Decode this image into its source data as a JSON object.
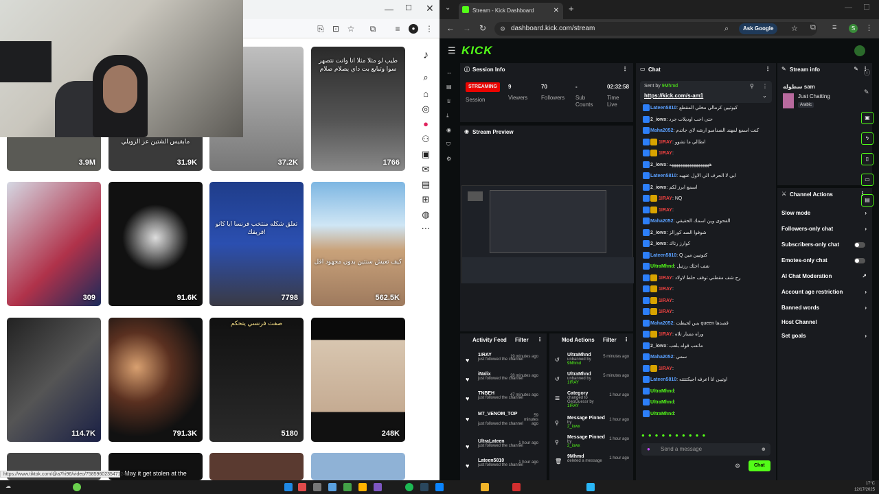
{
  "left_browser": {
    "status_url": "https://www.tiktok.com/@a7hi96/video/7585960235471244551",
    "tiles": [
      {
        "count": "3.9M",
        "caption": ""
      },
      {
        "count": "31.9K",
        "caption": "مابقيس الشتين عز الزويلي"
      },
      {
        "count": "37.2K",
        "caption": ""
      },
      {
        "count": "1766",
        "caption": "طيب لو مثلا مثلا انا وانت نتصهر سوا وتبايع بت داي يصلام صلام"
      },
      {
        "count": "309",
        "caption": ""
      },
      {
        "count": "91.6K",
        "caption": ""
      },
      {
        "count": "7798",
        "caption": "تعلق شكله منتخب فرنسا ايا كانو فريقك!"
      },
      {
        "count": "562.5K",
        "caption": "كيف تعيش سنتين بدون مجهود اقل"
      },
      {
        "count": "114.7K",
        "caption": ""
      },
      {
        "count": "791.3K",
        "caption": ""
      },
      {
        "count": "5180",
        "caption": "صفت فرنسي يتحكم"
      },
      {
        "count": "248K",
        "caption": ""
      },
      {
        "count": "",
        "caption": ""
      },
      {
        "count": "",
        "caption": "May it get stolen at the"
      },
      {
        "count": "",
        "caption": ""
      },
      {
        "count": "",
        "caption": ""
      }
    ]
  },
  "right_browser": {
    "tab_title": "Stream - Kick Dashboard",
    "url": "dashboard.kick.com/stream",
    "ask_google": "Ask Google",
    "logo": "KICK",
    "session": {
      "title": "Session Info",
      "status": "STREAMING",
      "session_label": "Session",
      "viewers_value": "9",
      "viewers_label": "Viewers",
      "followers_value": "70",
      "followers_label": "Followers",
      "subs_value": "-",
      "subs_label": "Sub Counts",
      "time_value": "02:32:58",
      "time_label": "Time Live"
    },
    "preview_title": "Stream Preview",
    "activity": {
      "title": "Activity Feed",
      "filter": "Filter",
      "items": [
        {
          "name": "1IRAY",
          "action": "just followed the channel",
          "time": "19 minutes ago"
        },
        {
          "name": "iNalix",
          "action": "just followed the channel",
          "time": "28 minutes ago"
        },
        {
          "name": "TNBEH",
          "action": "just followed the channel",
          "time": "47 minutes ago"
        },
        {
          "name": "M7_VENOM_TOP",
          "action": "just followed the channel",
          "time": "59 minutes ago"
        },
        {
          "name": "UltraLateen",
          "action": "just followed the channel",
          "time": "1 hour ago"
        },
        {
          "name": "Lateen5810",
          "action": "just followed the channel",
          "time": "1 hour ago"
        }
      ]
    },
    "mod": {
      "title": "Mod Actions",
      "filter": "Filter",
      "items": [
        {
          "name": "UltraMhnd",
          "l1": "unbanned by",
          "l2": "9Mhmd",
          "time": "5 minutes ago"
        },
        {
          "name": "UltraMhnd",
          "l1": "unbanned by",
          "l2": "1IRAY",
          "time": "5 minutes ago"
        },
        {
          "name": "Category",
          "l1": "changed to GeoGuessr by",
          "l2": "1IRAY",
          "time": "1 hour ago"
        },
        {
          "name": "Message Pinned",
          "l1": "by",
          "l2": "2_iowx",
          "time": "1 hour ago"
        },
        {
          "name": "Message Pinned",
          "l1": "by",
          "l2": "2_iowx",
          "time": "1 hour ago"
        },
        {
          "name": "9Mhmd",
          "l1": "deleted a message",
          "l2": "",
          "time": "1 hour ago"
        }
      ]
    },
    "chat": {
      "title": "Chat",
      "pinned_by": "Sent by",
      "pinned_user": "9Mhmd",
      "pinned_link": "https://kick.com/s-am1",
      "messages": [
        {
          "user": "Lateen5810",
          "text": "كيوتيين كرمالي مخلي المقطع"
        },
        {
          "user": "2_iowx",
          "text": "حتى احب اوديلات جرد"
        },
        {
          "user": "Maha2052",
          "text": "كنت اسمع لمهند الصدامبو ارشه لاي جاتدم"
        },
        {
          "user": "1IRAY",
          "text": "انطالي ما تشوو"
        },
        {
          "user": "1IRAY",
          "text": ""
        },
        {
          "user": "2_iowx",
          "text": "ههههههههههههههههههه"
        },
        {
          "user": "Lateen5810",
          "text": "ابي لا الحرف الي الاول عنهيه"
        },
        {
          "user": "2_iowx",
          "text": "اسمع ابرز لكم"
        },
        {
          "user": "1IRAY",
          "text": "NQ"
        },
        {
          "user": "1IRAY",
          "text": ""
        },
        {
          "user": "Maha2052",
          "text": "الفحوى وين اسمك الحقيقي"
        },
        {
          "user": "2_iowx",
          "text": "شوفوا الصد كورالز"
        },
        {
          "user": "2_iowx",
          "text": "كوارز رتاك"
        },
        {
          "user": "Lateen5810",
          "text": "Q كتوتيين مين"
        },
        {
          "user": "UltraMhnd",
          "text": "شف اجلك رزتيل"
        },
        {
          "user": "1IRAY",
          "text": "رح شف مقطني توقف حلط لاولاد"
        },
        {
          "user": "1IRAY",
          "text": ""
        },
        {
          "user": "1IRAY",
          "text": ""
        },
        {
          "user": "1IRAY",
          "text": ""
        },
        {
          "user": "Maha2052",
          "text": "بس لحيظت queen قصدها"
        },
        {
          "user": "1IRAY",
          "text": "وراه مسار تلاه"
        },
        {
          "user": "2_iowx",
          "text": "ماتعب قوله بلعب"
        },
        {
          "user": "Maha2052",
          "text": "سمي"
        },
        {
          "user": "1IRAY",
          "text": ""
        },
        {
          "user": "Lateen5810",
          "text": "اوتيين انا اعرفه اجيكتتتته"
        },
        {
          "user": "UltraMhnd",
          "text": ""
        },
        {
          "user": "UltraMhnd",
          "text": ""
        },
        {
          "user": "UltraMhnd",
          "text": ""
        }
      ],
      "input_placeholder": "Send a message",
      "send_label": "Chat"
    },
    "stream_info": {
      "title": "Stream info",
      "stream_title": "سطوله sam",
      "category": "Just Chatting",
      "tag": "Arabic"
    },
    "channel_actions": {
      "title": "Channel Actions",
      "items": [
        {
          "label": "Slow mode",
          "kind": "arrow"
        },
        {
          "label": "Followers-only chat",
          "kind": "arrow"
        },
        {
          "label": "Subscribers-only chat",
          "kind": "toggle"
        },
        {
          "label": "Emotes-only chat",
          "kind": "toggle"
        },
        {
          "label": "AI Chat Moderation",
          "kind": "link"
        },
        {
          "label": "Account age restriction",
          "kind": "arrow"
        },
        {
          "label": "Banned words",
          "kind": "arrow"
        },
        {
          "label": "Host Channel",
          "kind": "none"
        },
        {
          "label": "Set goals",
          "kind": "arrow"
        }
      ]
    }
  },
  "taskbar": {
    "time": "17°C",
    "date": "12/17/2025"
  },
  "colors": {
    "kick_green": "#53fc18",
    "streaming_red": "#eb0400",
    "panel": "#191b1f"
  }
}
